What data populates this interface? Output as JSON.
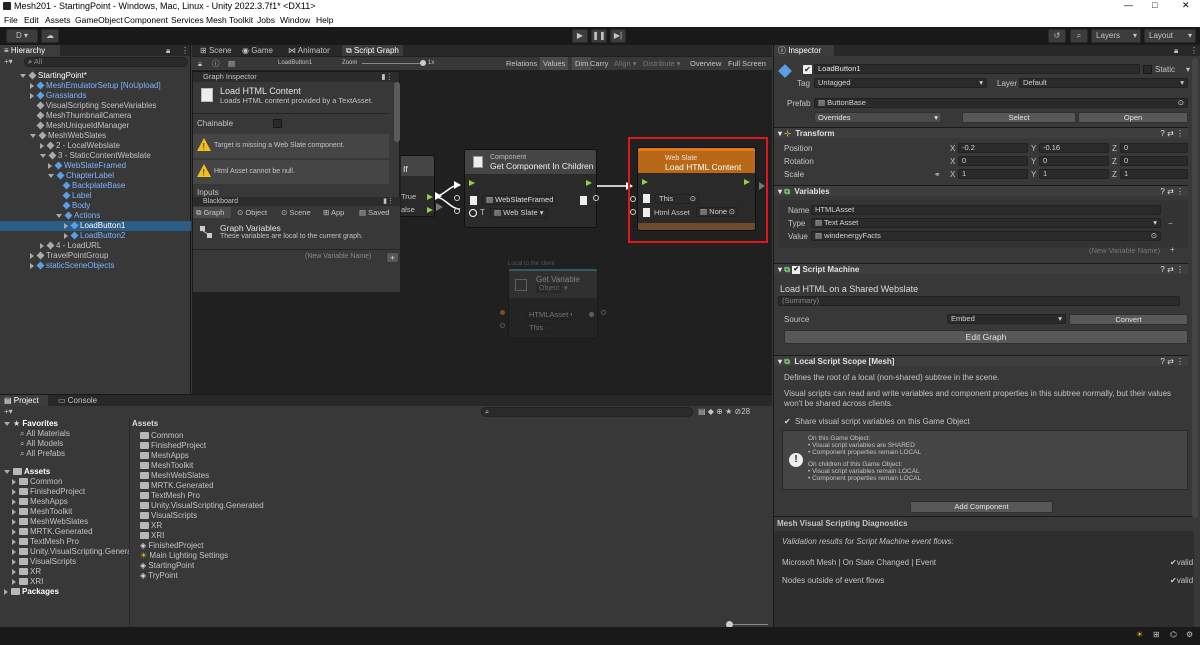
{
  "window": {
    "title": "Mesh201 - StartingPoint - Windows, Mac, Linux - Unity 2022.3.7f1* <DX11>"
  },
  "menu": [
    "File",
    "Edit",
    "Assets",
    "GameObject",
    "Component",
    "Services",
    "Mesh Toolkit",
    "Jobs",
    "Window",
    "Help"
  ],
  "toolbar": {
    "account": "D",
    "layers": "Layers",
    "layout": "Layout"
  },
  "hierarchy": {
    "tab": "Hierarchy",
    "search_placeholder": "All",
    "rows": [
      {
        "label": "StartingPoint*"
      },
      {
        "label": "MeshEmulatorSetup [NoUpload]"
      },
      {
        "label": "Grasslands"
      },
      {
        "label": "VisualScripting SceneVariables"
      },
      {
        "label": "MeshThumbnailCamera"
      },
      {
        "label": "MeshUniqueIdManager"
      },
      {
        "label": "MeshWebSlates"
      },
      {
        "label": "2 - LocalWebslate"
      },
      {
        "label": "3 - StaticContentWebslate"
      },
      {
        "label": "WebSlateFramed"
      },
      {
        "label": "ChapterLabel"
      },
      {
        "label": "BackplateBase"
      },
      {
        "label": "Label"
      },
      {
        "label": "Body"
      },
      {
        "label": "Actions"
      },
      {
        "label": "LoadButton1"
      },
      {
        "label": "LoadButton2"
      },
      {
        "label": "4 - LoadURL"
      },
      {
        "label": "TravelPointGroup"
      },
      {
        "label": "staticSceneObjects"
      }
    ]
  },
  "scene_tabs": [
    "Scene",
    "Game",
    "Animator",
    "Script Graph"
  ],
  "graph_toolbar": {
    "breadcrumb": "LoadButton1",
    "zoom_label": "Zoom",
    "zoom_value": "1x",
    "relations": "Relations",
    "values": "Values",
    "dim": "Dim",
    "carry": "Carry",
    "align": "Align",
    "distribute": "Distribute",
    "overview": "Overview",
    "fullscreen": "Full Screen"
  },
  "graph_inspector": {
    "title": "Graph Inspector",
    "node_title": "Load HTML Content",
    "node_desc": "Loads HTML content provided by a TextAsset.",
    "chainable": "Chainable",
    "warning1": "Target is missing a Web Slate component.",
    "warning2": "Html Asset cannot be null.",
    "inputs": "Inputs"
  },
  "blackboard": {
    "title": "Blackboard",
    "tabs": [
      "Graph",
      "Object",
      "Scene",
      "App",
      "Saved"
    ],
    "vars_title": "Graph Variables",
    "vars_desc": "These variables are local to the current graph.",
    "new_var": "(New Variable Name)"
  },
  "nodes": {
    "if": {
      "title": "If",
      "true": "True",
      "false": "alse"
    },
    "component": {
      "category": "Component",
      "title": "Get Component In Children",
      "in1": "WebSlateFramed",
      "type": "Web Slate"
    },
    "webslate": {
      "category": "Web Slate",
      "title": "Load HTML Content",
      "this": "This",
      "html": "Html Asset",
      "none": "None"
    },
    "getvar": {
      "header": "Local to the client",
      "title": "Get Variable",
      "sub": "Object",
      "name": "HTMLAsset",
      "this": "This"
    }
  },
  "inspector": {
    "tab": "Inspector",
    "object_name": "LoadButton1",
    "static": "Static",
    "tag_label": "Tag",
    "tag": "Untagged",
    "layer_label": "Layer",
    "layer": "Default",
    "prefab_label": "Prefab",
    "prefab": "ButtonBase",
    "overrides": "Overrides",
    "select": "Select",
    "open": "Open",
    "transform": {
      "title": "Transform",
      "position": "Position",
      "rotation": "Rotation",
      "scale": "Scale",
      "pos": [
        "-0.2",
        "-0.16",
        "0"
      ],
      "rot": [
        "0",
        "0",
        "0"
      ],
      "scl": [
        "1",
        "1",
        "1"
      ]
    },
    "variables": {
      "title": "Variables",
      "name_label": "Name",
      "name": "HTMLAsset",
      "type_label": "Type",
      "type": "Text Asset",
      "value_label": "Value",
      "value": "windenergyFacts",
      "new_var": "(New Variable Name)"
    },
    "script_machine": {
      "title": "Script Machine",
      "name": "Load HTML on a Shared Webslate",
      "summary": "(Summary)",
      "source_label": "Source",
      "source": "Embed",
      "convert": "Convert",
      "edit": "Edit Graph"
    },
    "local_scope": {
      "title": "Local Script Scope [Mesh]",
      "desc1": "Defines the root of a local (non-shared) subtree in the scene.",
      "desc2": "Visual scripts can read and write variables and component properties in this subtree normally, but their values won't be shared across clients.",
      "share": "Share visual script variables on this Game Object",
      "info": [
        "On this Game Object:",
        "• Visual script variables are SHARED",
        "• Component properties remain LOCAL",
        "On children of this Game Object:",
        "• Visual script variables remain LOCAL",
        "• Component properties remain LOCAL"
      ]
    },
    "add_component": "Add Component",
    "diagnostics": {
      "title": "Mesh Visual Scripting Diagnostics",
      "subtitle": "Validation results for Script Machine event flows:",
      "row1": "Microsoft Mesh | On State Changed | Event",
      "row2": "Nodes outside of event flows",
      "valid": "valid"
    }
  },
  "project": {
    "tabs": [
      "Project",
      "Console"
    ],
    "count": "28",
    "favorites": {
      "title": "Favorites",
      "items": [
        "All Materials",
        "All Models",
        "All Prefabs"
      ]
    },
    "assets_tree": {
      "title": "Assets",
      "items": [
        "Common",
        "FinishedProject",
        "MeshApps",
        "MeshToolkit",
        "MeshWebSlates",
        "MRTK.Generated",
        "TextMesh Pro",
        "Unity.VisualScripting.Genera",
        "VisualScripts",
        "XR",
        "XRI"
      ],
      "packages": "Packages"
    },
    "assets_title": "Assets",
    "asset_list": [
      {
        "label": "Common",
        "kind": "folder"
      },
      {
        "label": "FinishedProject",
        "kind": "folder"
      },
      {
        "label": "MeshApps",
        "kind": "folder"
      },
      {
        "label": "MeshToolkit",
        "kind": "folder"
      },
      {
        "label": "MeshWebSlates",
        "kind": "folder"
      },
      {
        "label": "MRTK.Generated",
        "kind": "folder"
      },
      {
        "label": "TextMesh Pro",
        "kind": "folder"
      },
      {
        "label": "Unity.VisualScripting.Generated",
        "kind": "folder"
      },
      {
        "label": "VisualScripts",
        "kind": "folder"
      },
      {
        "label": "XR",
        "kind": "folder"
      },
      {
        "label": "XRI",
        "kind": "folder"
      },
      {
        "label": "FinishedProject",
        "kind": "scene"
      },
      {
        "label": "Main Lighting Settings",
        "kind": "lighting"
      },
      {
        "label": "StartingPoint",
        "kind": "scene"
      },
      {
        "label": "TryPoint",
        "kind": "scene"
      }
    ]
  },
  "colors": {
    "accent_blue": "#7fb4ff",
    "selection": "#2c5d87",
    "highlight_red": "#e0161b",
    "webslate_orange": "#e07a1f",
    "flow_green": "#8fd14f",
    "warn_yellow": "#f2c018"
  }
}
